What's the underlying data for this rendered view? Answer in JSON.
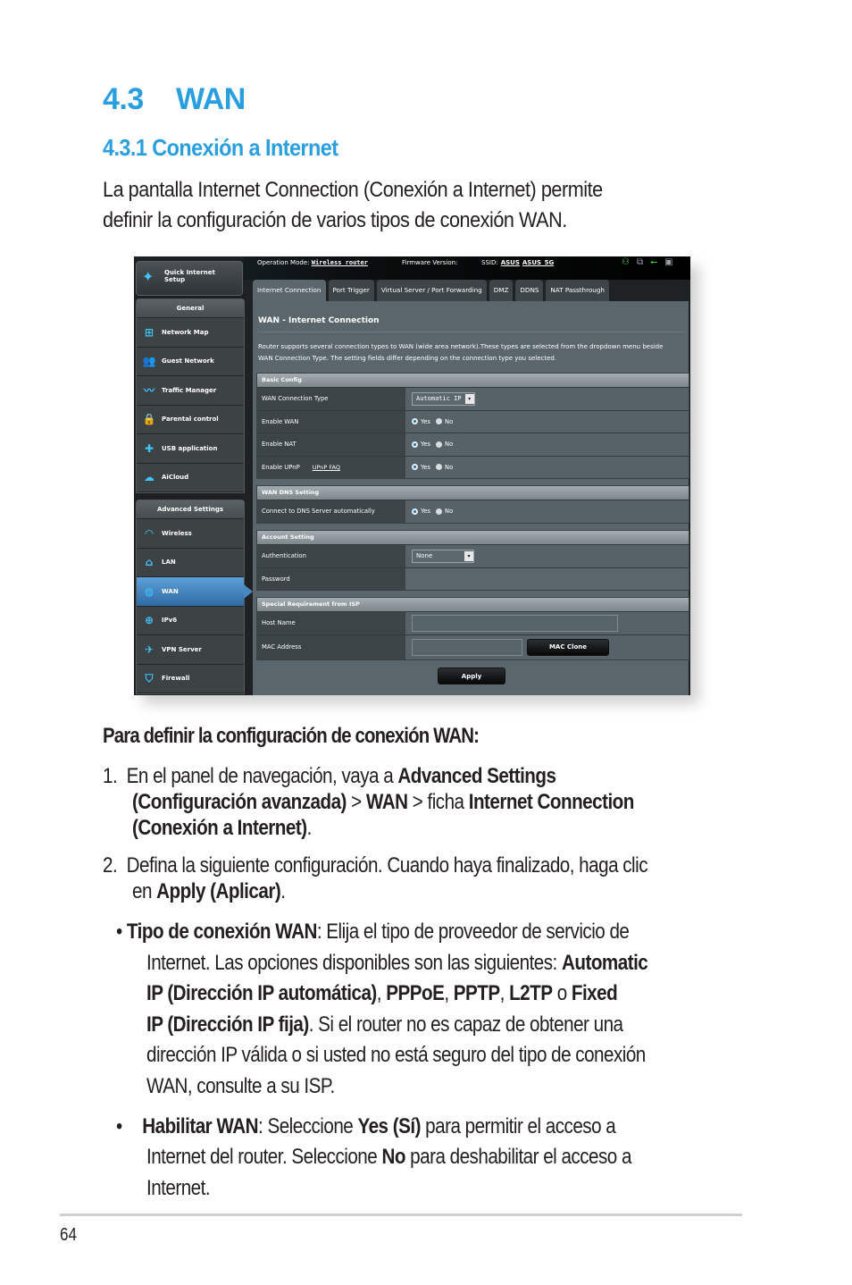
{
  "heading": {
    "number": "4.3",
    "title": "WAN"
  },
  "subheading": "4.3.1 Conexión a Internet",
  "intro": [
    "La pantalla Internet Connection (Conexión a Internet) permite",
    "definir la configuración de varios tipos de conexión WAN."
  ],
  "router_ui": {
    "quick_setup": {
      "icon": "magic-wand-icon",
      "label_line1": "Quick Internet",
      "label_line2": "Setup"
    },
    "topbar": {
      "operation_mode_label": "Operation Mode:",
      "operation_mode_value": "Wireless router",
      "firmware_label": "Firmware Version:",
      "ssid_label": "SSID:",
      "ssid_values": [
        "ASUS",
        "ASUS_5G"
      ],
      "status_icons": [
        "user-status-icon",
        "network-clients-icon",
        "usb-icon",
        "printer-icon"
      ]
    },
    "sidebar": {
      "general_title": "General",
      "general_items": [
        {
          "label": "Network Map",
          "icon": "network-map-icon"
        },
        {
          "label": "Guest Network",
          "icon": "guest-network-icon"
        },
        {
          "label": "Traffic Manager",
          "icon": "traffic-manager-icon"
        },
        {
          "label": "Parental control",
          "icon": "lock-icon"
        },
        {
          "label": "USB application",
          "icon": "puzzle-icon"
        },
        {
          "label": "AiCloud",
          "icon": "cloud-icon"
        }
      ],
      "advanced_title": "Advanced Settings",
      "advanced_items": [
        {
          "label": "Wireless",
          "icon": "wifi-icon"
        },
        {
          "label": "LAN",
          "icon": "home-icon"
        },
        {
          "label": "WAN",
          "icon": "globe-icon",
          "active": true
        },
        {
          "label": "IPv6",
          "icon": "ipv6-icon"
        },
        {
          "label": "VPN Server",
          "icon": "vpn-icon"
        },
        {
          "label": "Firewall",
          "icon": "shield-icon"
        }
      ]
    },
    "tabs": [
      "Internet Connection",
      "Port Trigger",
      "Virtual Server / Port Forwarding",
      "DMZ",
      "DDNS",
      "NAT Passthrough"
    ],
    "active_tab": "Internet Connection",
    "page_title": "WAN - Internet Connection",
    "description_line1": "Router supports several connection types to WAN (wide area network).These types are selected from the dropdown menu beside",
    "description_line2": "WAN Connection Type. The setting fields differ depending on the connection type you selected.",
    "basic_config": {
      "title": "Basic Config",
      "wan_connection_type_label": "WAN Connection Type",
      "wan_connection_type_value": "Automatic IP",
      "enable_wan_label": "Enable WAN",
      "enable_nat_label": "Enable NAT",
      "enable_upnp_label": "Enable UPnP",
      "upnp_faq_link": "UPnP  FAQ",
      "yes": "Yes",
      "no": "No"
    },
    "dns_setting": {
      "title": "WAN DNS Setting",
      "connect_dns_label": "Connect to DNS Server automatically"
    },
    "account_setting": {
      "title": "Account Setting",
      "authentication_label": "Authentication",
      "authentication_value": "None",
      "password_label": "Password"
    },
    "isp_requirement": {
      "title": "Special Requirement from ISP",
      "host_name_label": "Host Name",
      "host_name_value": "",
      "mac_address_label": "MAC Address",
      "mac_address_value": "",
      "mac_clone_button": "MAC Clone"
    },
    "apply_button": "Apply"
  },
  "instructions": {
    "title": "Para definir la configuración de conexión WAN:",
    "step1": {
      "num": "1.",
      "t1": "En el panel de navegación, vaya a ",
      "b1": "Advanced Settings",
      "b2": "(Configuración avanzada)",
      "t2": " > ",
      "b3": "WAN",
      "t3": " > ficha ",
      "b4": "Internet Connection",
      "b5": "(Conexión a Internet)",
      "t4": "."
    },
    "step2": {
      "num": "2.",
      "t1": "Defina la siguiente configuración. Cuando haya finalizado, haga clic",
      "t2": "en ",
      "b1": "Apply (Aplicar)",
      "t3": "."
    },
    "bullet1": {
      "b1": "Tipo de conexión WAN",
      "t1": ": Elija el tipo de proveedor de servicio de",
      "t2": "Internet. Las opciones disponibles son las siguientes: ",
      "b2": "Automatic",
      "b3": "IP (Dirección IP automática)",
      "t3": ", ",
      "b4": "PPPoE",
      "t4": ", ",
      "b5": "PPTP",
      "t5": ", ",
      "b6": "L2TP",
      "t6": " o ",
      "b7": "Fixed",
      "b8": "IP (Dirección IP fija)",
      "t7": ". Si el router no es capaz de obtener una",
      "t8": "dirección IP válida o si usted no está seguro del tipo de conexión",
      "t9": "WAN, consulte a su ISP."
    },
    "bullet2": {
      "b1": "Habilitar WAN",
      "t1": ": Seleccione ",
      "b2": "Yes (Sí)",
      "t2": " para permitir el acceso a",
      "t3": "Internet del router. Seleccione ",
      "b3": "No",
      "t4": " para deshabilitar el acceso a",
      "t5": "Internet."
    }
  },
  "page_number": "64"
}
